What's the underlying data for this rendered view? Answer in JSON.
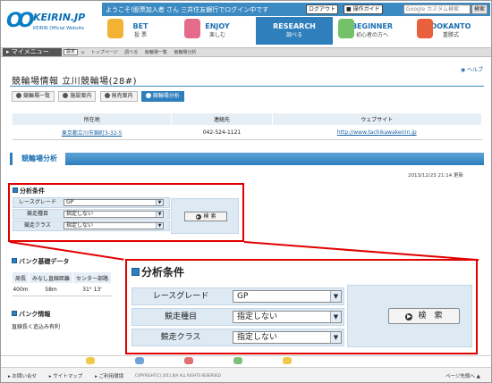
{
  "header": {
    "logo_text": "KEIRIN.JP",
    "logo_sub": "KEIRIN Official Website",
    "welcome": "ようこそ!股票加入者 さん 三井住友銀行でログイン中です",
    "logout": "ログアウト",
    "guide": "操作ガイド",
    "search_placeholder": "Google カスタム検索",
    "search_button": "検索"
  },
  "nav": [
    {
      "title": "BET",
      "sub": "投 票"
    },
    {
      "title": "ENJOY",
      "sub": "楽しむ"
    },
    {
      "title": "RESEARCH",
      "sub": "調べる"
    },
    {
      "title": "BEGINNER",
      "sub": "初心者の方へ"
    },
    {
      "title": "DOKANTO",
      "sub": "重勝式"
    }
  ],
  "mymenu": {
    "label": "マイメニュー",
    "settings": "設定"
  },
  "breadcrumb": [
    "トップページ",
    "調べる",
    "競輪場一覧",
    "競輪場分析"
  ],
  "help": "ヘルプ",
  "page_title": "競輪場情報  立川競輪場(28#)",
  "tabs": [
    "競輪場一覧",
    "施設案内",
    "発売案内",
    "競輪場分析"
  ],
  "info": {
    "headers": [
      "所在地",
      "連絡先",
      "ウェブサイト"
    ],
    "address": "東京都立川市錦町3-32-5",
    "phone": "042-524-1121",
    "website": "http://www.tachikawakeirin.jp"
  },
  "section_title": "競輪場分析",
  "updated": "2013/12/23 21:14 更新",
  "analysis": {
    "title": "分析条件",
    "rows": [
      {
        "label": "レースグレード",
        "value": "GP"
      },
      {
        "label": "競走種目",
        "value": "指定しない"
      },
      {
        "label": "競走クラス",
        "value": "指定しない"
      }
    ],
    "search_button": "検 索",
    "search_button_big": "検　索"
  },
  "bank": {
    "title": "バンク基礎データ",
    "headers": [
      "周長",
      "みなし直線距離",
      "センター部路"
    ],
    "row": [
      "400m",
      "58m",
      "31° 13'"
    ]
  },
  "bank_info": {
    "title": "バンク情報",
    "text": "直線長く追込み有利"
  },
  "footer": {
    "links": [
      "お問い合せ",
      "サイトマップ",
      "ご利用環境"
    ],
    "copyright": "COPYRIGHT(C) 2011 JKA ALL RIGHTS RESERVED",
    "page_top": "ページ先頭へ"
  },
  "colors": {
    "accent": "#2f7fbd",
    "highlight": "#e00000",
    "row_bg": "#dde9f3"
  }
}
